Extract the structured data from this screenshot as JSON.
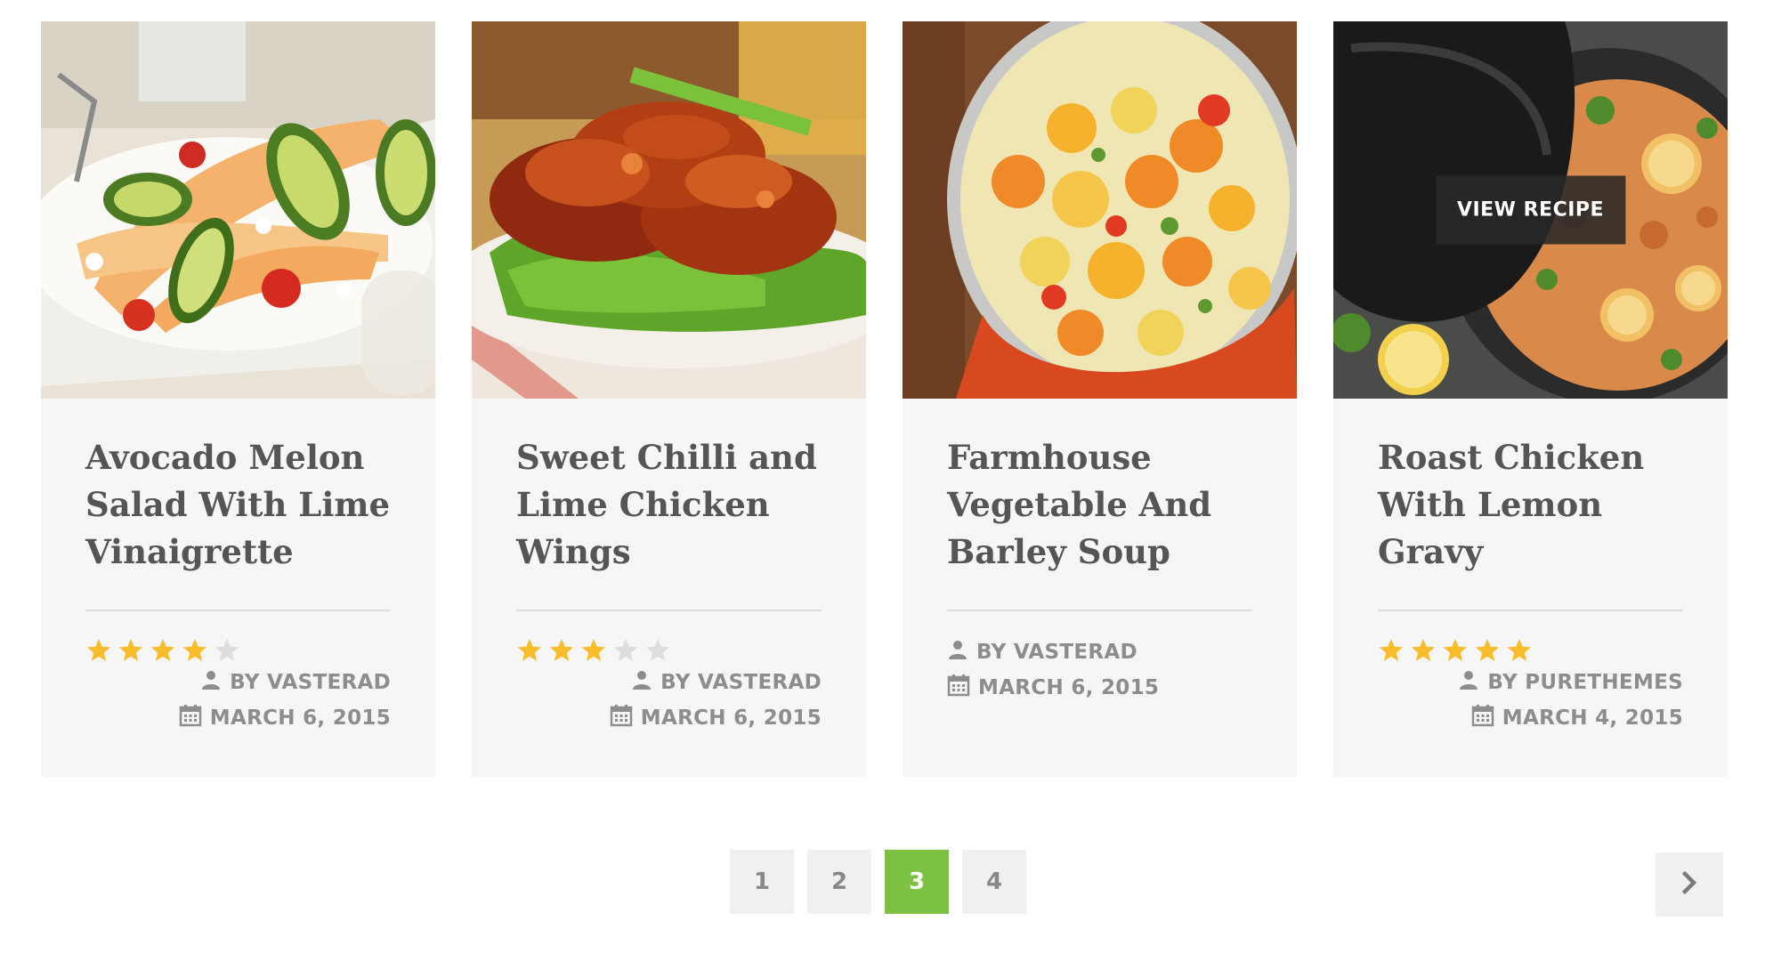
{
  "recipes": [
    {
      "title": "Avocado Melon Salad With Lime Vinaigrette",
      "rating": 4,
      "author": "BY VASTERAD",
      "date": "MARCH 6, 2015"
    },
    {
      "title": "Sweet Chilli and Lime Chicken Wings",
      "rating": 3,
      "author": "BY VASTERAD",
      "date": "MARCH 6, 2015"
    },
    {
      "title": "Farmhouse Vegetable And Barley Soup",
      "rating": 0,
      "author": "BY VASTERAD",
      "date": "MARCH 6, 2015"
    },
    {
      "title": "Roast Chicken With Lemon Gravy",
      "rating": 5,
      "author": "BY PURETHEMES",
      "date": "MARCH 4, 2015",
      "hover_label": "VIEW RECIPE"
    }
  ],
  "pagination": {
    "pages": [
      "1",
      "2",
      "3",
      "4"
    ],
    "current": "3"
  },
  "colors": {
    "accent": "#7dc142",
    "star_filled": "#f7bd2b",
    "star_empty": "#dddddd",
    "meta_text": "#8d8d8d",
    "card_bg": "#f6f6f6"
  },
  "icons": {
    "author": "user-icon",
    "date": "calendar-icon",
    "next": "chevron-right-icon"
  }
}
